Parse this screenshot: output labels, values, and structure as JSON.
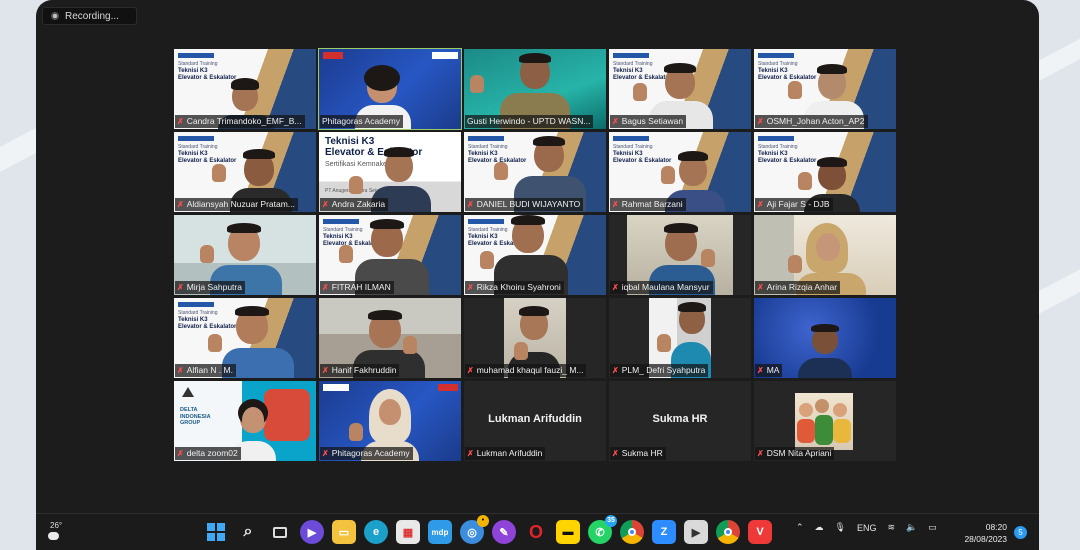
{
  "recording": {
    "label": "Recording..."
  },
  "participants": [
    {
      "name": "Candra Trimandoko_EMF_B...",
      "muted": true
    },
    {
      "name": "Phitagoras Academy",
      "muted": false,
      "active": true
    },
    {
      "name": "Gusti Herwindo - UPTD WASN...",
      "muted": false
    },
    {
      "name": "Bagus Setiawan",
      "muted": true
    },
    {
      "name": "OSMH_Johan Acton_AP2",
      "muted": true
    },
    {
      "name": "Aldiansyah Nuzuar Pratam...",
      "muted": true
    },
    {
      "name": "Andra Zakaria",
      "muted": true
    },
    {
      "name": "DANIEL BUDI WIJAYANTO",
      "muted": true
    },
    {
      "name": "Rahmat Barzani",
      "muted": true
    },
    {
      "name": "Aji Fajar S - DJB",
      "muted": true
    },
    {
      "name": "Mirja Sahputra",
      "muted": true
    },
    {
      "name": "FITRAH ILMAN",
      "muted": true
    },
    {
      "name": "Rikza Khoiru Syahroni",
      "muted": true
    },
    {
      "name": "iqbal Maulana Mansyur",
      "muted": true
    },
    {
      "name": "Arina Rizqia Anhar",
      "muted": true
    },
    {
      "name": "Alfian N . M.",
      "muted": true
    },
    {
      "name": "Hanif Fakhruddin",
      "muted": true
    },
    {
      "name": "muhamad khaqul fauzi_ M...",
      "muted": true
    },
    {
      "name": "PLM_ Defri Syahputra",
      "muted": true
    },
    {
      "name": "MA",
      "muted": true
    },
    {
      "name": "delta zoom02",
      "muted": true
    },
    {
      "name": "Phitagoras Academy",
      "muted": true
    },
    {
      "name": "Lukman Arifuddin",
      "muted": true,
      "no_video": true
    },
    {
      "name": "Sukma HR",
      "muted": true,
      "no_video": true
    },
    {
      "name": "DSM Nita Apriani",
      "muted": true
    }
  ],
  "slide": {
    "small_title": "Standard Training",
    "line1": "Teknisi K3",
    "line2": "Elevator & Eskalator",
    "sub": "Sertifikasi Kemnaker",
    "big_line1": "Teknisi K3",
    "big_line2": "Elevator & Eskalator",
    "big_sub": "Sertifikasi Kemnaker",
    "presenter": "PT Anugerah Putra Sejati",
    "delta_text": "DELTA INDONESIA GROUP"
  },
  "taskbar": {
    "temperature": "26°",
    "language": "ENG",
    "time": "08:20",
    "date": "28/08/2023",
    "notification_count": "5",
    "whatsapp_badge": "35",
    "icons": [
      "windows-start",
      "search",
      "task-view",
      "meet",
      "file-explorer",
      "edge",
      "store",
      "mdp",
      "chrome-profile",
      "notes",
      "opera",
      "sticky-notes",
      "whatsapp",
      "chrome",
      "zoom",
      "video",
      "chrome-2",
      "vivaldi"
    ]
  }
}
